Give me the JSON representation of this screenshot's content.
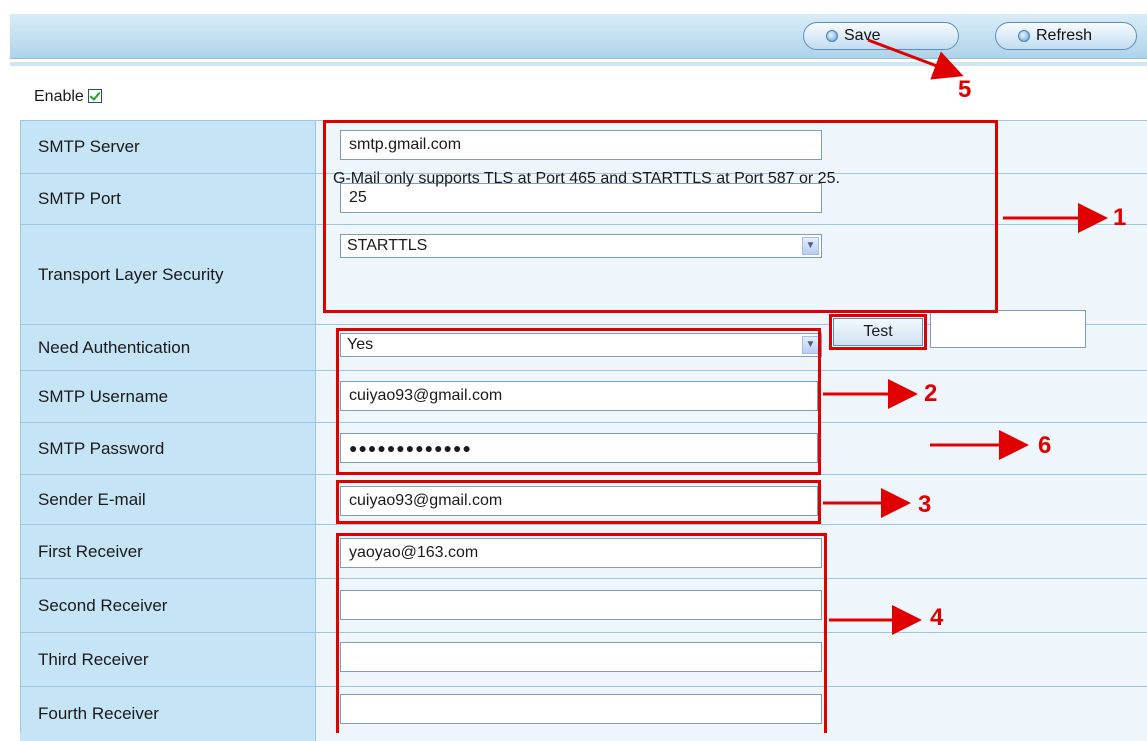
{
  "toolbar": {
    "save_label": "Save",
    "refresh_label": "Refresh"
  },
  "enable": {
    "label": "Enable",
    "checked": true
  },
  "form": {
    "smtp_server": {
      "label": "SMTP Server",
      "value": "smtp.gmail.com"
    },
    "smtp_port": {
      "label": "SMTP Port",
      "value": "25"
    },
    "tls": {
      "label": "Transport Layer Security",
      "selected": "STARTTLS",
      "hint": "G-Mail only supports TLS at Port 465 and STARTTLS at Port 587 or 25."
    },
    "need_auth": {
      "label": "Need Authentication",
      "selected": "Yes"
    },
    "smtp_username": {
      "label": "SMTP Username",
      "value": "cuiyao93@gmail.com"
    },
    "smtp_password": {
      "label": "SMTP Password",
      "value": "●●●●●●●●●●●●●",
      "test_label": "Test"
    },
    "sender_email": {
      "label": "Sender E-mail",
      "value": "cuiyao93@gmail.com"
    },
    "first_receiver": {
      "label": "First Receiver",
      "value": "yaoyao@163.com"
    },
    "second_receiver": {
      "label": "Second Receiver",
      "value": ""
    },
    "third_receiver": {
      "label": "Third Receiver",
      "value": ""
    },
    "fourth_receiver": {
      "label": "Fourth Receiver",
      "value": ""
    }
  },
  "annotations": {
    "n1": "1",
    "n2": "2",
    "n3": "3",
    "n4": "4",
    "n5": "5",
    "n6": "6"
  },
  "colors": {
    "annotation": "#e00000",
    "label_bg": "#c5e4f5",
    "value_bg": "#eef6fb"
  }
}
